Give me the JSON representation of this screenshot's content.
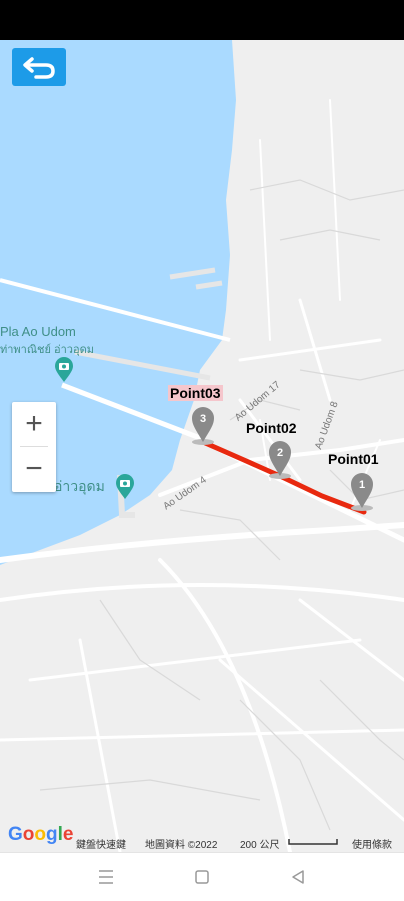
{
  "map": {
    "poi_1_line1": "Pla Ao Udom",
    "poi_1_line2": "ท่าพาณิชย์ อ่าวอุดม",
    "poi_2": "อ่าวอุดม",
    "roads": [
      "Ao Udom 17",
      "Ao Udom 8",
      "Ao Udom 4"
    ],
    "route_color": "#e8290f",
    "water_color": "#aadaff",
    "points": [
      {
        "label": "Point01",
        "number": "1",
        "highlighted": false
      },
      {
        "label": "Point02",
        "number": "2",
        "highlighted": false
      },
      {
        "label": "Point03",
        "number": "3",
        "highlighted": true
      }
    ]
  },
  "controls": {
    "back_icon": "back-arrow-icon",
    "zoom_in": "+",
    "zoom_out": "−"
  },
  "attribution": {
    "logo": "Google",
    "shortcuts": "鍵盤快速鍵",
    "map_data": "地圖資料 ©2022",
    "scale": "200 公尺",
    "terms": "使用條款"
  },
  "nav": [
    "menu-icon",
    "home-icon",
    "back-icon"
  ]
}
